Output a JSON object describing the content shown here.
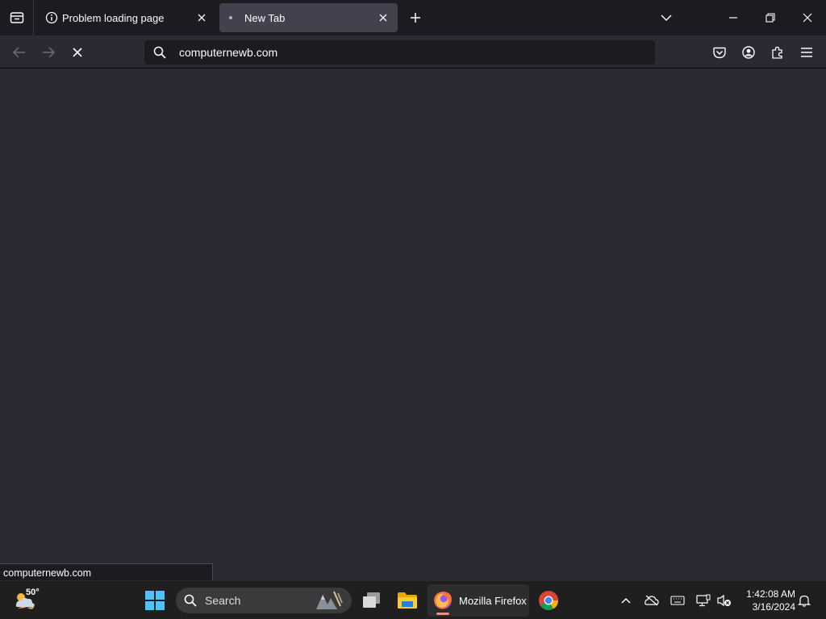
{
  "tabstrip": {
    "tabs": [
      {
        "title": "Problem loading page",
        "icon": "info-icon",
        "active": false
      },
      {
        "title": "New Tab",
        "icon": "loading-dot-icon",
        "active": true
      }
    ]
  },
  "navbar": {
    "url": "computernewb.com",
    "loading": true
  },
  "status": {
    "text": "computernewb.com"
  },
  "taskbar": {
    "weather_temp": "50°",
    "search_label": "Search",
    "active_app_label": "Mozilla Firefox",
    "clock_time": "1:42:08 AM",
    "clock_date": "3/16/2024"
  },
  "colors": {
    "chrome_dark": "#1c1b22",
    "content_bg": "#2b2a33",
    "active_tab": "#42414d",
    "taskbar": "#1f1f1f"
  }
}
